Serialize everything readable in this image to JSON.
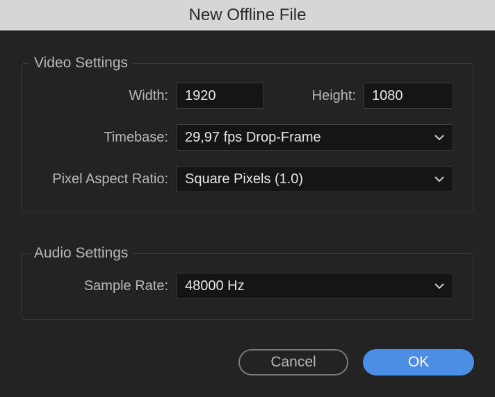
{
  "window": {
    "title": "New Offline File"
  },
  "video": {
    "legend": "Video Settings",
    "width_label": "Width:",
    "width_value": "1920",
    "height_label": "Height:",
    "height_value": "1080",
    "timebase_label": "Timebase:",
    "timebase_value": "29,97 fps Drop-Frame",
    "par_label": "Pixel Aspect Ratio:",
    "par_value": "Square Pixels (1.0)"
  },
  "audio": {
    "legend": "Audio Settings",
    "sample_rate_label": "Sample Rate:",
    "sample_rate_value": "48000 Hz"
  },
  "buttons": {
    "cancel": "Cancel",
    "ok": "OK"
  },
  "colors": {
    "accent": "#4b8ee3",
    "background": "#232323",
    "titlebar": "#d6d6d6"
  }
}
